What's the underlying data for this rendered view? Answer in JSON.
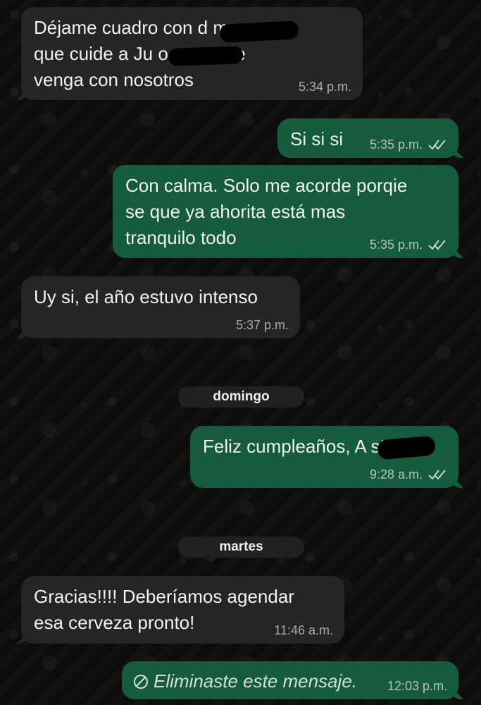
{
  "chat": {
    "messages": [
      {
        "text": "Déjame cuadro con d        ma para\nque cuide a Ju        o para que\nvenga con nosotros",
        "time": "5:34 p.m."
      },
      {
        "text": "Si si si",
        "time": "5:35 p.m."
      },
      {
        "text": "Con calma. Solo me acorde porqie\nse que ya ahorita está mas\ntranquilo todo",
        "time": "5:35 p.m."
      },
      {
        "text": "Uy si, el año estuvo intenso",
        "time": "5:37 p.m."
      },
      {
        "text": "Feliz cumpleaños, A        s!",
        "time": "9:28 a.m."
      },
      {
        "text": "Gracias!!!! Deberíamos agendar\nesa cerveza pronto!",
        "time": "11:46 a.m."
      },
      {
        "text": "Eliminaste este mensaje.",
        "time": "12:03 p.m."
      }
    ],
    "dates": {
      "domingo": "domingo",
      "martes": "martes"
    }
  },
  "colors": {
    "incoming_bubble": "#252525",
    "outgoing_bubble": "#145c3d",
    "background": "#0b0b0b"
  },
  "icons": {
    "read_receipt": "double-check-icon",
    "deleted_message": "blocked-circle-icon"
  }
}
